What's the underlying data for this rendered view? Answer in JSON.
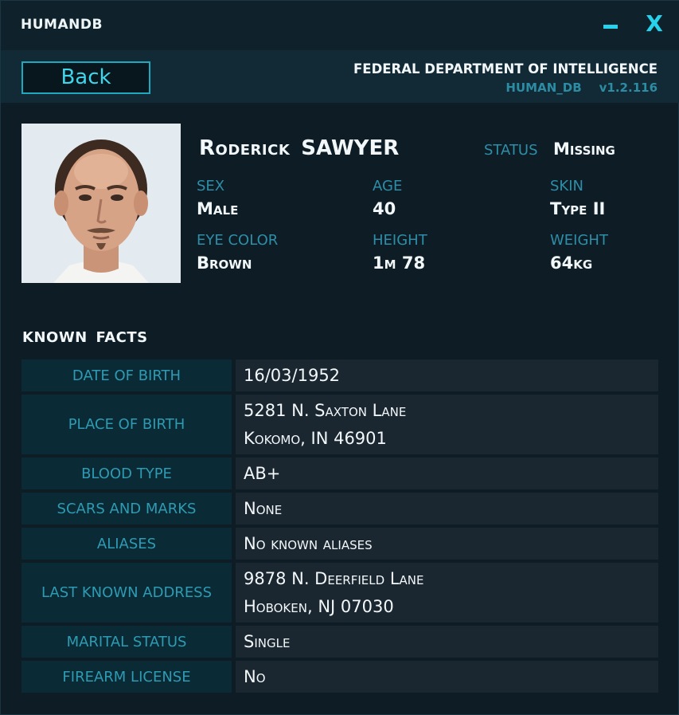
{
  "window": {
    "app_title": "HUMANDB",
    "minimize_icon": "minimize-icon",
    "close_label": "X"
  },
  "header": {
    "back_label": "Back",
    "agency": "FEDERAL DEPARTMENT OF INTELLIGENCE",
    "db_name": "HUMAN_DB",
    "version": "v1.2.116"
  },
  "colors": {
    "accent": "#27d3ec",
    "label": "#2e8ea7",
    "text": "#f2f7f9",
    "background": "#0d1c25"
  },
  "profile": {
    "photo_icon": "portrait-photo",
    "first_name": "Roderick",
    "last_name": "SAWYER",
    "status_label": "STATUS",
    "status_value": "Missing",
    "attributes": [
      {
        "label": "SEX",
        "value": "Male"
      },
      {
        "label": "AGE",
        "value": "40"
      },
      {
        "label": "SKIN",
        "value": "Type II"
      },
      {
        "label": "EYE COLOR",
        "value": "Brown"
      },
      {
        "label": "HEIGHT",
        "value": "1m 78"
      },
      {
        "label": "WEIGHT",
        "value": "64kg"
      }
    ]
  },
  "known_facts": {
    "title": "KNOWN FACTS",
    "rows": [
      {
        "label": "DATE OF BIRTH",
        "lines": [
          "16/03/1952"
        ]
      },
      {
        "label": "PLACE OF BIRTH",
        "lines": [
          "5281 N. Saxton Lane",
          "Kokomo, IN 46901"
        ]
      },
      {
        "label": "BLOOD TYPE",
        "lines": [
          "AB+"
        ]
      },
      {
        "label": "SCARS AND MARKS",
        "lines": [
          "None"
        ]
      },
      {
        "label": "ALIASES",
        "lines": [
          "No known aliases"
        ]
      },
      {
        "label": "LAST KNOWN ADDRESS",
        "lines": [
          "9878 N. Deerfield Lane",
          "Hoboken, NJ 07030"
        ]
      },
      {
        "label": "MARITAL STATUS",
        "lines": [
          "Single"
        ]
      },
      {
        "label": "FIREARM LICENSE",
        "lines": [
          "No"
        ]
      }
    ]
  }
}
